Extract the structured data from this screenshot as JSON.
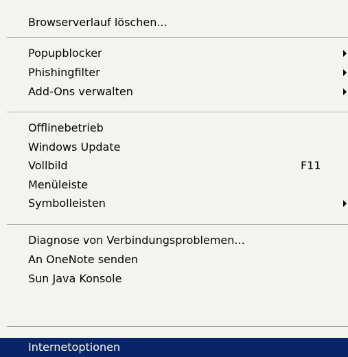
{
  "menu": {
    "groups": [
      {
        "items": [
          {
            "label": "Browserverlauf löschen..."
          }
        ]
      },
      {
        "items": [
          {
            "label": "Popupblocker",
            "icon": "submenu-arrow-icon"
          },
          {
            "label": "Phishingfilter",
            "icon": "submenu-arrow-icon"
          },
          {
            "label": "Add-Ons verwalten",
            "icon": "submenu-arrow-icon"
          }
        ]
      },
      {
        "items": [
          {
            "label": "Offlinebetrieb"
          },
          {
            "label": "Windows Update"
          },
          {
            "label": "Vollbild",
            "shortcut": "F11"
          },
          {
            "label": "Menüleiste"
          },
          {
            "label": "Symbolleisten",
            "icon": "submenu-arrow-icon"
          }
        ]
      },
      {
        "items": [
          {
            "label": "Diagnose von Verbindungsproblemen..."
          },
          {
            "label": "An OneNote senden"
          },
          {
            "label": "Sun Java Konsole"
          }
        ]
      },
      {
        "items": [
          {
            "label": "Internetoptionen",
            "highlighted": true
          }
        ]
      }
    ],
    "colors": {
      "background": "#f3f3ef",
      "highlight": "#0a246a",
      "highlight_text": "#ffffff",
      "separator": "#a5a5a0"
    }
  }
}
